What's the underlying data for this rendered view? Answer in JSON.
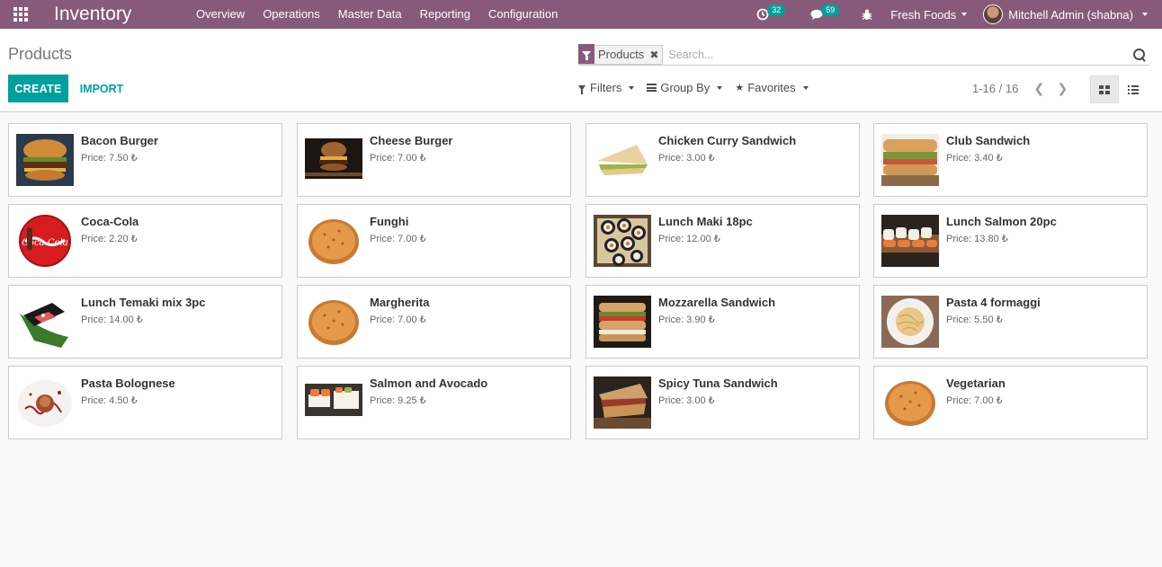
{
  "app": {
    "title": "Inventory",
    "menu": [
      "Overview",
      "Operations",
      "Master Data",
      "Reporting",
      "Configuration"
    ]
  },
  "systray": {
    "activity_count": "32",
    "message_count": "59",
    "company": "Fresh Foods",
    "user": "Mitchell Admin (shabna)"
  },
  "control": {
    "breadcrumb": "Products",
    "create_label": "CREATE",
    "import_label": "IMPORT",
    "facet_label": "Products",
    "facet_remove": "✖",
    "search_placeholder": "Search...",
    "filters_label": "Filters",
    "groupby_label": "Group By",
    "favorites_label": "Favorites",
    "pager": "1-16 / 16"
  },
  "products": [
    {
      "name": "Bacon Burger",
      "price": "Price: 7.50 ₺",
      "image": "burger"
    },
    {
      "name": "Cheese Burger",
      "price": "Price: 7.00 ₺",
      "image": "burger-dark"
    },
    {
      "name": "Chicken Curry Sandwich",
      "price": "Price: 3.00 ₺",
      "image": "sandwich-triangle"
    },
    {
      "name": "Club Sandwich",
      "price": "Price: 3.40 ₺",
      "image": "club-sandwich"
    },
    {
      "name": "Coca-Cola",
      "price": "Price: 2.20 ₺",
      "image": "coca-cola"
    },
    {
      "name": "Funghi",
      "price": "Price: 7.00 ₺",
      "image": "pizza"
    },
    {
      "name": "Lunch Maki 18pc",
      "price": "Price: 12.00 ₺",
      "image": "maki"
    },
    {
      "name": "Lunch Salmon 20pc",
      "price": "Price: 13.80 ₺",
      "image": "salmon-sushi"
    },
    {
      "name": "Lunch Temaki mix 3pc",
      "price": "Price: 14.00 ₺",
      "image": "temaki"
    },
    {
      "name": "Margherita",
      "price": "Price: 7.00 ₺",
      "image": "pizza"
    },
    {
      "name": "Mozzarella Sandwich",
      "price": "Price: 3.90 ₺",
      "image": "mozzarella-sandwich"
    },
    {
      "name": "Pasta 4 formaggi",
      "price": "Price: 5.50 ₺",
      "image": "pasta-plate"
    },
    {
      "name": "Pasta Bolognese",
      "price": "Price: 4.50 ₺",
      "image": "bolognese"
    },
    {
      "name": "Salmon and Avocado",
      "price": "Price: 9.25 ₺",
      "image": "salmon-avocado"
    },
    {
      "name": "Spicy Tuna Sandwich",
      "price": "Price: 3.00 ₺",
      "image": "tuna-sandwich"
    },
    {
      "name": "Vegetarian",
      "price": "Price: 7.00 ₺",
      "image": "pizza"
    }
  ],
  "colors": {
    "navbar": "#875a7b",
    "accent": "#00a09d"
  }
}
